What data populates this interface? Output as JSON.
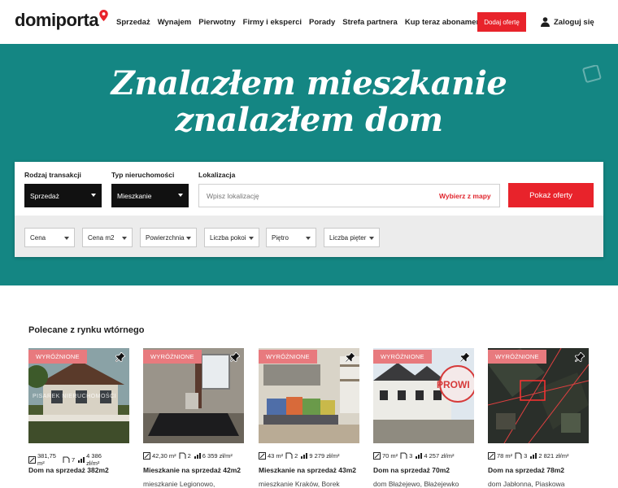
{
  "header": {
    "logo_text": "domiporta",
    "nav": [
      "Sprzedaż",
      "Wynajem",
      "Pierwotny",
      "Firmy i eksperci",
      "Porady",
      "Strefa partnera",
      "Kup teraz abonament"
    ],
    "add_offer": "Dodaj ofertę",
    "login": "Zaloguj się"
  },
  "hero": {
    "line1": "Znalazłem mieszkanie",
    "line2": "znalazłem dom"
  },
  "search": {
    "transaction_label": "Rodzaj transakcji",
    "transaction_value": "Sprzedaż",
    "property_label": "Typ nieruchomości",
    "property_value": "Mieszkanie",
    "location_label": "Lokalizacja",
    "location_placeholder": "Wpisz lokalizację",
    "map_link": "Wybierz z mapy",
    "submit": "Pokaż oferty",
    "filters": [
      "Cena",
      "Cena m2",
      "Powierzchnia",
      "Liczba pokoi",
      "Piętro",
      "Liczba pięter"
    ]
  },
  "section": {
    "title": "Polecane z rynku wtórnego"
  },
  "cards": [
    {
      "badge": "WYRÓŻNIONE",
      "area": "381,75 m²",
      "rooms": "7",
      "price": "4 386 zł/m²",
      "title": "Dom na sprzedaż 382m2",
      "subtitle": "",
      "watermark": "PISAREK NIERUCHOMOŚCI"
    },
    {
      "badge": "WYRÓŻNIONE",
      "area": "42,30 m²",
      "rooms": "2",
      "price": "6 359 zł/m²",
      "title": "Mieszkanie na sprzedaż 42m2",
      "subtitle": "mieszkanie Legionowo,",
      "watermark": ""
    },
    {
      "badge": "WYRÓŻNIONE",
      "area": "43 m²",
      "rooms": "2",
      "price": "9 279 zł/m²",
      "title": "Mieszkanie na sprzedaż 43m2",
      "subtitle": "mieszkanie Kraków, Borek",
      "watermark": ""
    },
    {
      "badge": "WYRÓŻNIONE",
      "area": "70 m²",
      "rooms": "3",
      "price": "4 257 zł/m²",
      "title": "Dom na sprzedaż 70m2",
      "subtitle": "dom Błażejewo, Błażejewko",
      "watermark": "PROWI"
    },
    {
      "badge": "WYRÓŻNIONE",
      "area": "78 m²",
      "rooms": "3",
      "price": "2 821 zł/m²",
      "title": "Dom na sprzedaż 78m2",
      "subtitle": "dom Jabłonna, Piaskowa",
      "watermark": ""
    }
  ],
  "colors": {
    "brand_red": "#e8232b",
    "hero_teal": "#148683",
    "badge_pink": "#e87a7e"
  },
  "icons": {
    "user": "user-icon",
    "pin": "pushpin-icon",
    "area": "area-icon",
    "rooms": "door-icon",
    "price": "price-chart-icon"
  }
}
